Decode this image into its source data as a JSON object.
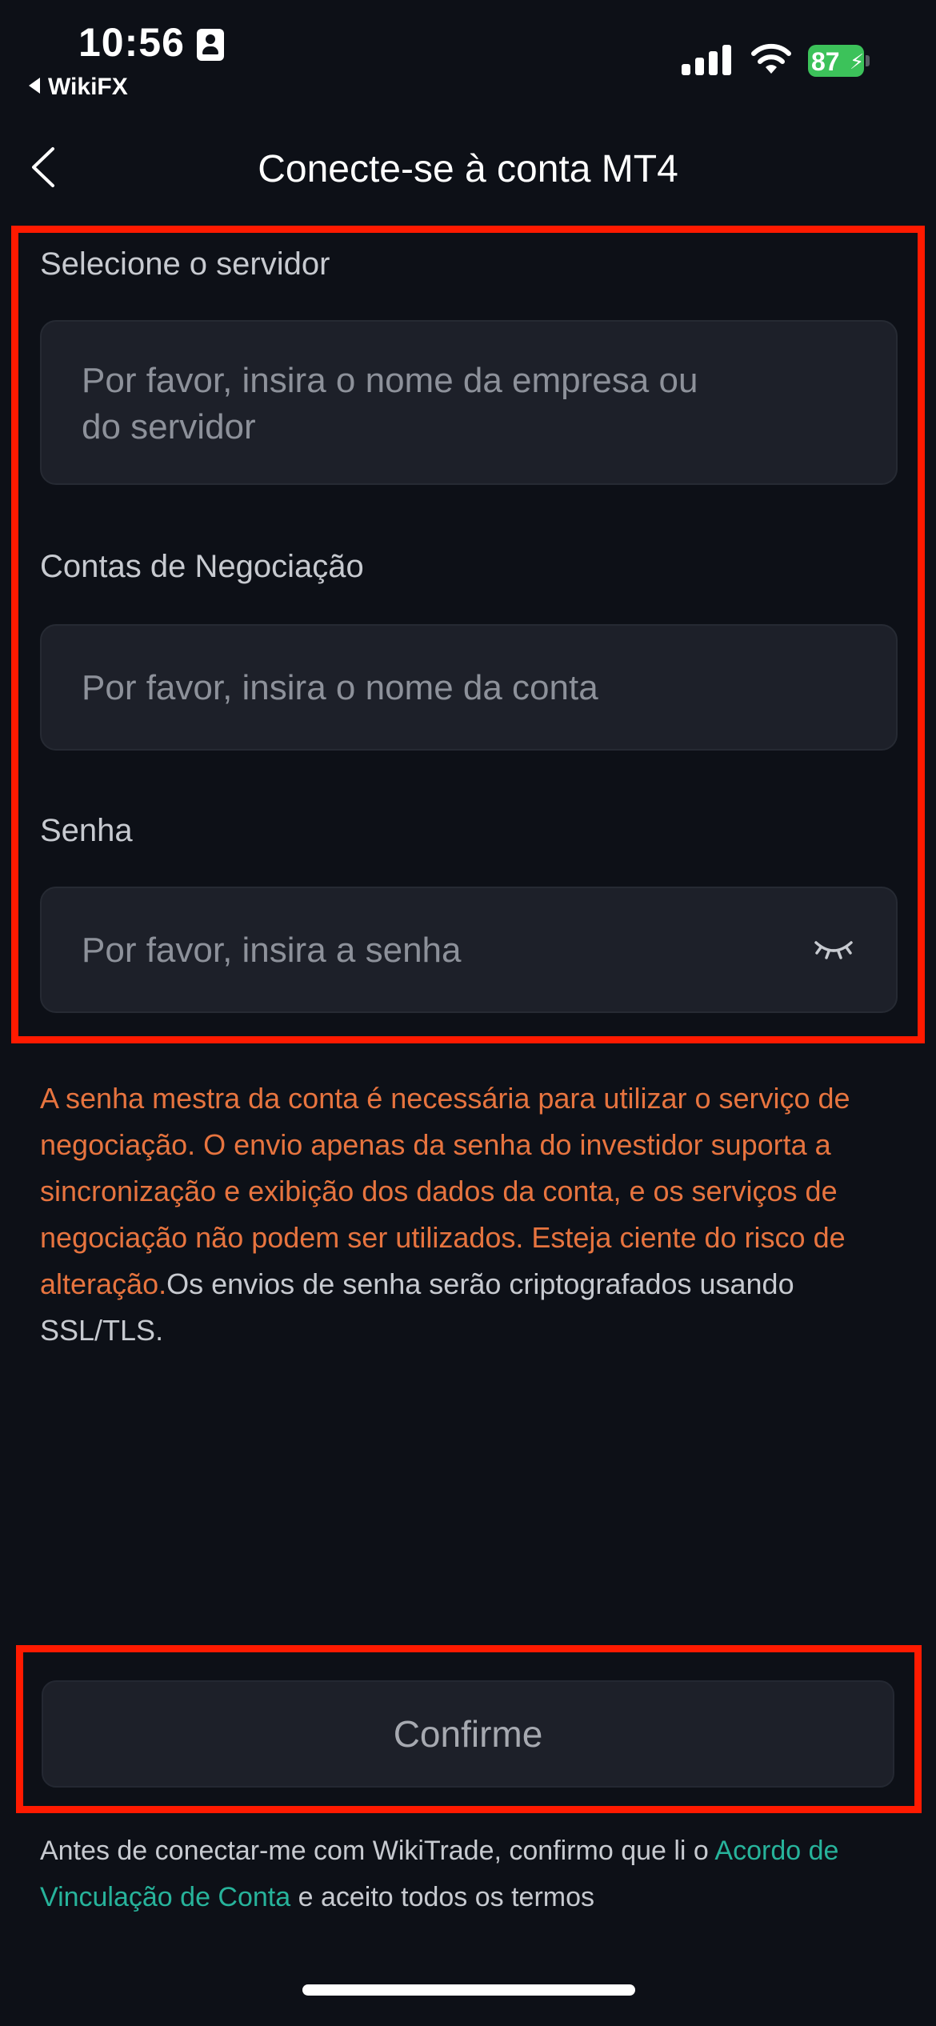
{
  "status_bar": {
    "time": "10:56",
    "back_app": "WikiFX",
    "battery_percent": "87",
    "icons": [
      "contact-card-icon",
      "cellular-signal-icon",
      "wifi-icon",
      "battery-charging-icon"
    ]
  },
  "header": {
    "title": "Conecte-se à conta MT4",
    "back_icon": "chevron-left-icon"
  },
  "form": {
    "server": {
      "label": "Selecione o servidor",
      "placeholder_line1": "Por favor, insira o nome da empresa ou",
      "placeholder_line2": "do servidor"
    },
    "account": {
      "label": "Contas de Negociação",
      "placeholder": "Por favor, insira o nome da conta"
    },
    "password": {
      "label": "Senha",
      "placeholder": "Por favor, insira a senha",
      "toggle_icon": "eye-closed-icon"
    }
  },
  "notice": {
    "warning_text": "A senha mestra da conta é necessária para utilizar o serviço de negociação. O envio apenas da senha do investidor suporta a sincronização e exibição dos dados da conta, e os serviços de negociação não podem ser utilizados. Esteja ciente do risco de alteração.",
    "info_text": "Os envios de senha serão criptografados usando SSL/TLS."
  },
  "confirm": {
    "label": "Confirme"
  },
  "agreement": {
    "prefix": "Antes de conectar-me com WikiTrade, confirmo que li o ",
    "link": "Acordo de Vinculação de Conta",
    "suffix": " e aceito todos os termos"
  },
  "colors": {
    "background": "#0d1017",
    "field": "#1d2029",
    "warning": "#e7743f",
    "link": "#27b39b",
    "highlight": "#ff1a00",
    "battery": "#3cc25a"
  }
}
